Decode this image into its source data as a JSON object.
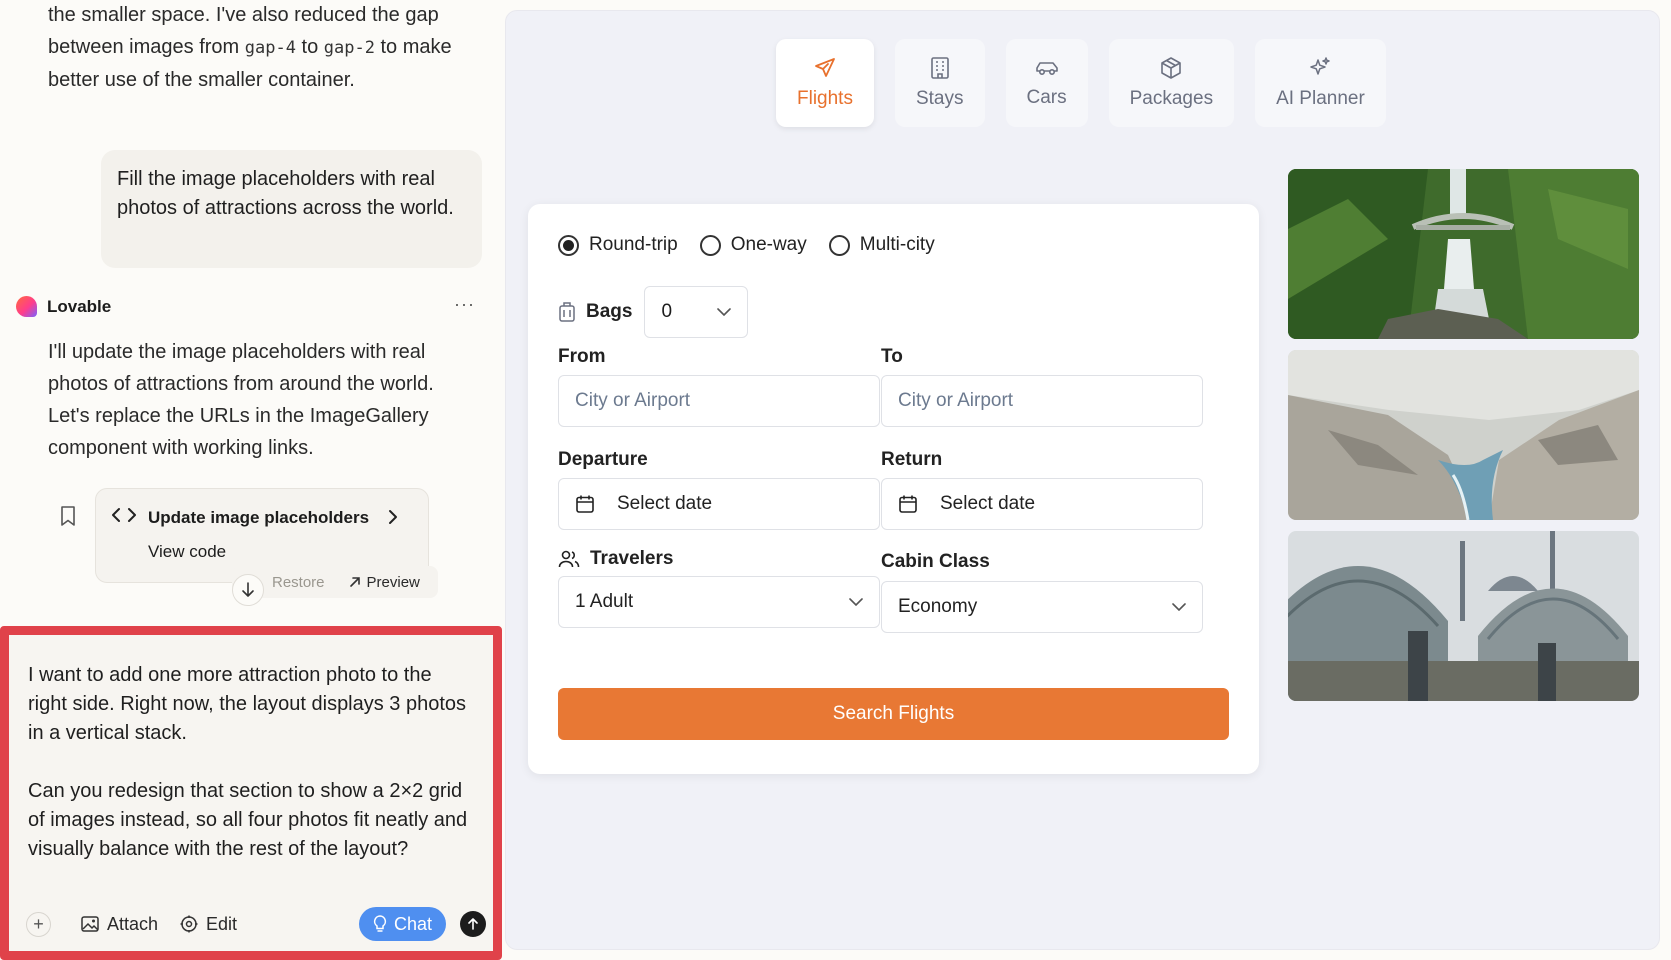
{
  "chat": {
    "top_message": {
      "part1": "the smaller space. I've also reduced the gap between images from ",
      "code1": "gap-4",
      "part2": " to ",
      "code2": "gap-2",
      "part3": " to make better use of the smaller container."
    },
    "user_message": "Fill the image placeholders with real photos of attractions across the world.",
    "assistant_name": "Lovable",
    "assistant_message": "I'll update the image placeholders with real photos of attractions from around the world. Let's replace the URLs in the ImageGallery component with working links.",
    "code_card": {
      "title": "Update image placeholders",
      "subtitle": "View code",
      "restore_label": "Restore",
      "preview_label": "Preview"
    },
    "input": {
      "prompt": "I want to add one more attraction photo to the right side. Right now, the layout displays 3 photos in a vertical stack.\n\nCan you redesign that section to show a 2×2 grid of images instead, so all four photos fit neatly and visually balance with the rest of the layout?",
      "attach_label": "Attach",
      "edit_label": "Edit",
      "chat_label": "Chat",
      "highlight_color": "#e0424a"
    }
  },
  "preview": {
    "tabs": [
      {
        "label": "Flights",
        "icon": "plane-icon",
        "active": true
      },
      {
        "label": "Stays",
        "icon": "building-icon",
        "active": false
      },
      {
        "label": "Cars",
        "icon": "car-icon",
        "active": false
      },
      {
        "label": "Packages",
        "icon": "package-icon",
        "active": false
      },
      {
        "label": "AI Planner",
        "icon": "sparkles-icon",
        "active": false
      }
    ],
    "trip_types": [
      {
        "label": "Round-trip",
        "selected": true
      },
      {
        "label": "One-way",
        "selected": false
      },
      {
        "label": "Multi-city",
        "selected": false
      }
    ],
    "bags": {
      "label": "Bags",
      "value": "0"
    },
    "from": {
      "label": "From",
      "placeholder": "City or Airport"
    },
    "to": {
      "label": "To",
      "placeholder": "City or Airport"
    },
    "departure": {
      "label": "Departure",
      "value": "Select date"
    },
    "return": {
      "label": "Return",
      "value": "Select date"
    },
    "travelers": {
      "label": "Travelers",
      "value": "1 Adult"
    },
    "cabin_class": {
      "label": "Cabin Class",
      "value": "Economy"
    },
    "search_button": "Search Flights",
    "accent_color": "#e87834",
    "gallery": [
      {
        "subject": "waterfall-with-bridge"
      },
      {
        "subject": "canyon-with-river"
      },
      {
        "subject": "mosque-domes"
      }
    ]
  }
}
